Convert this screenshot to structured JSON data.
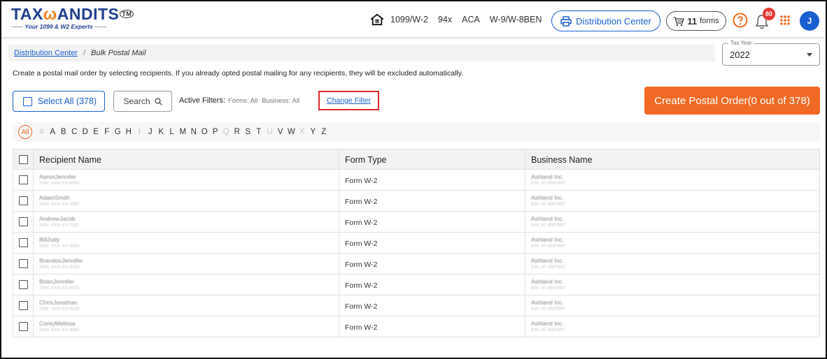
{
  "header": {
    "logo_text_left": "TAX",
    "logo_text_owl": "ω",
    "logo_text_right": "ANDITS",
    "logo_tm": "TM",
    "logo_tagline": "Your 1099 & W2 Experts",
    "nav_links": [
      "1099/W-2",
      "94x",
      "ACA",
      "W-9/W-8BEN"
    ],
    "distribution_center_label": "Distribution Center",
    "cart_count": "11",
    "cart_label": "forms",
    "notification_count": "80",
    "avatar_initial": "J"
  },
  "breadcrumb": {
    "link": "Distribution Center",
    "separator": "/",
    "current": "Bulk Postal Mail"
  },
  "tax_year": {
    "label": "Tax Year",
    "value": "2022"
  },
  "info_text": "Create a postal mail order by selecting recipients. If you already opted postal mailing for any recipients, they will be excluded automatically.",
  "toolbar": {
    "select_all_label": "Select All (378)",
    "search_label": "Search",
    "active_filters_label": "Active Filters:",
    "forms_filter": "Forms: All",
    "business_filter": "Business: All",
    "change_filter_label": "Change Filter",
    "create_order_label": "Create Postal Order(0 out of 378)"
  },
  "alphabet": {
    "all_label": "All",
    "letters": [
      {
        "l": "#",
        "dim": true
      },
      {
        "l": "A",
        "dim": false
      },
      {
        "l": "B",
        "dim": false
      },
      {
        "l": "C",
        "dim": false
      },
      {
        "l": "D",
        "dim": false
      },
      {
        "l": "E",
        "dim": false
      },
      {
        "l": "F",
        "dim": false
      },
      {
        "l": "G",
        "dim": false
      },
      {
        "l": "H",
        "dim": false
      },
      {
        "l": "I",
        "dim": true
      },
      {
        "l": "J",
        "dim": false
      },
      {
        "l": "K",
        "dim": false
      },
      {
        "l": "L",
        "dim": false
      },
      {
        "l": "M",
        "dim": false
      },
      {
        "l": "N",
        "dim": false
      },
      {
        "l": "O",
        "dim": false
      },
      {
        "l": "P",
        "dim": false
      },
      {
        "l": "Q",
        "dim": true
      },
      {
        "l": "R",
        "dim": false
      },
      {
        "l": "S",
        "dim": false
      },
      {
        "l": "T",
        "dim": false
      },
      {
        "l": "U",
        "dim": true
      },
      {
        "l": "V",
        "dim": false
      },
      {
        "l": "W",
        "dim": false
      },
      {
        "l": "X",
        "dim": true
      },
      {
        "l": "Y",
        "dim": false
      },
      {
        "l": "Z",
        "dim": false
      }
    ]
  },
  "table": {
    "columns": [
      "Recipient Name",
      "Form Type",
      "Business Name"
    ],
    "rows": [
      {
        "recipient": "AaronJennifer",
        "tin": "SSN: XXX-XX-9092",
        "form": "Form W-2",
        "business": "Ashland Inc.",
        "ein": "EIN: 47-4597897"
      },
      {
        "recipient": "AdamSmith",
        "tin": "SSN: XXX-XX-7087",
        "form": "Form W-2",
        "business": "Ashland Inc.",
        "ein": "EIN: 47-4597897"
      },
      {
        "recipient": "AndrewJacob",
        "tin": "SSN: XXX-XX-7011",
        "form": "Form W-2",
        "business": "Ashland Inc.",
        "ein": "EIN: 47-4597897"
      },
      {
        "recipient": "BillJudy",
        "tin": "SSN: XXX-XX-9084",
        "form": "Form W-2",
        "business": "Ashland Inc.",
        "ein": "EIN: 47-4597897"
      },
      {
        "recipient": "BrandonJennifer",
        "tin": "SSN: XXX-XX-9030",
        "form": "Form W-2",
        "business": "Ashland Inc.",
        "ein": "EIN: 47-4597897"
      },
      {
        "recipient": "BrianJennifer",
        "tin": "SSN: XXX-XX-9020",
        "form": "Form W-2",
        "business": "Ashland Inc.",
        "ein": "EIN: 47-4597897"
      },
      {
        "recipient": "ChrisJonathan",
        "tin": "SSN: XXX-XX-9036",
        "form": "Form W-2",
        "business": "Ashland Inc.",
        "ein": "EIN: 47-4597897"
      },
      {
        "recipient": "CoreyMelissa",
        "tin": "SSN: XXX-XX-9080",
        "form": "Form W-2",
        "business": "Ashland Inc.",
        "ein": "EIN: 47-4597897"
      }
    ]
  },
  "colors": {
    "brand_blue": "#1a5fd1",
    "logo_blue": "#1f3f8f",
    "accent_orange": "#f06a25",
    "highlight_red": "#e0272b",
    "badge_red": "#e53935"
  },
  "icons": [
    "home-icon",
    "printer-icon",
    "cart-icon",
    "help-icon",
    "bell-icon",
    "apps-grid-icon",
    "search-icon"
  ]
}
